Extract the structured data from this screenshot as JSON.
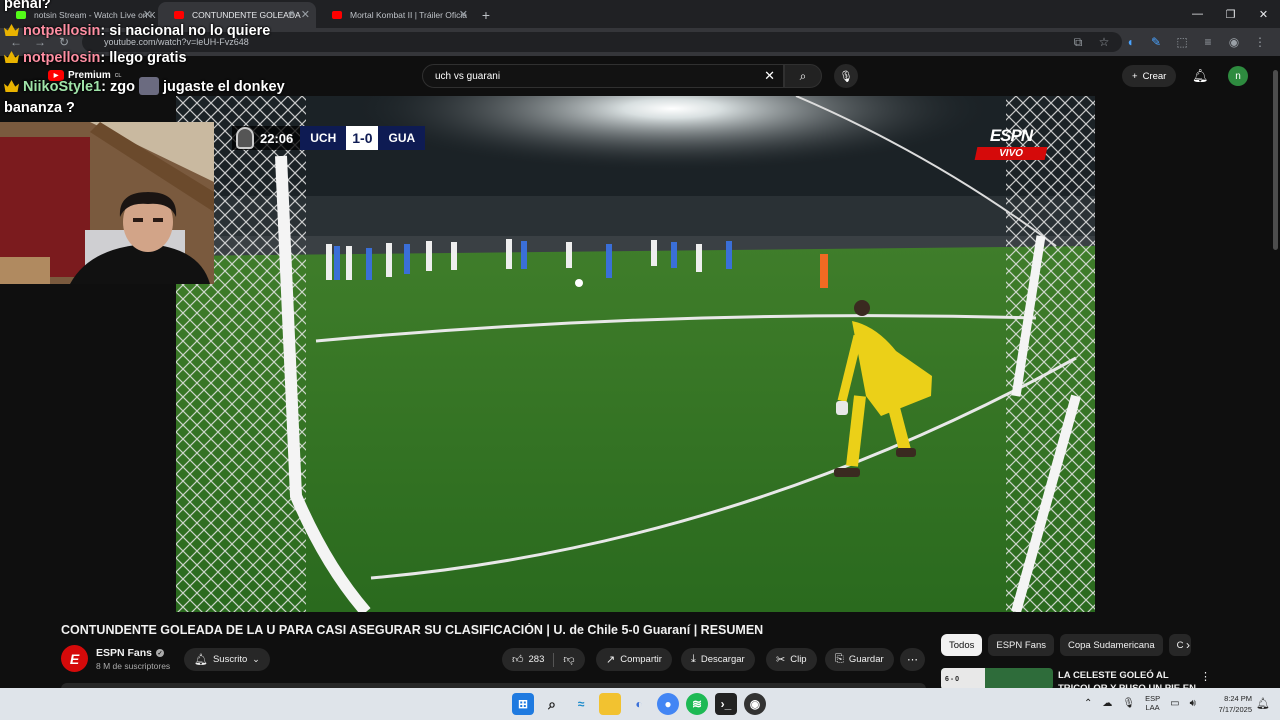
{
  "browser": {
    "tabs": [
      {
        "title": "notsin Stream - Watch Live on K",
        "favicon_color": "#53fc18",
        "active": false
      },
      {
        "title": "CONTUNDENTE GOLEADA",
        "favicon_color": "#ff0000",
        "active": true,
        "audio": true
      },
      {
        "title": "Mortal Kombat II | Tráiler Oficia",
        "favicon_color": "#ff0000",
        "active": false
      }
    ],
    "url": "youtube.com/watch?v=leUH-Fvz648"
  },
  "youtube": {
    "logo_text": "Premium",
    "logo_region": "CL",
    "search_query": "uch vs guarani",
    "create_label": "Crear",
    "user_initial": "n"
  },
  "scoreboard": {
    "time": "22:06",
    "home": "UCH",
    "score": "1-0",
    "away": "GUA"
  },
  "broadcaster": {
    "logo": "ESPN",
    "live_label": "VIVO"
  },
  "video": {
    "title": "CONTUNDENTE GOLEADA DE LA U PARA CASI ASEGURAR SU CLASIFICACIÓN | U. de Chile 5-0 Guaraní | RESUMEN",
    "channel": "ESPN Fans",
    "channel_initial": "E",
    "subscribers": "8 M de suscriptores",
    "subscribed_label": "Suscrito",
    "likes": "283",
    "share_label": "Compartir",
    "download_label": "Descargar",
    "clip_label": "Clip",
    "save_label": "Guardar"
  },
  "recommendations": {
    "chips": [
      "Todos",
      "ESPN Fans",
      "Copa Sudamericana",
      "C"
    ],
    "first_title": "LA CELESTE GOLEÓ AL TRICOLOR Y PUSO UN PIE EN",
    "first_thumb_text": "6 - 0"
  },
  "chat": {
    "lines": [
      {
        "user": "",
        "message": "penal?",
        "user_color": "#ffffff",
        "crown": false
      },
      {
        "user": "notpellosin",
        "message": ": si nacional no lo quiere",
        "user_color": "#ff8fa3",
        "crown": true
      },
      {
        "user": "notpellosin",
        "message": ": llego gratis",
        "user_color": "#ff8fa3",
        "crown": true
      },
      {
        "user": "NiikoStyle1",
        "message": ": zgo",
        "user_color": "#9fe3a8",
        "crown": true,
        "message_tail": "jugaste el donkey"
      },
      {
        "user": "",
        "message": "bananza ?",
        "user_color": "#ffffff",
        "crown": false
      }
    ]
  },
  "taskbar": {
    "lang_top": "ESP",
    "lang_bottom": "LAA",
    "time": "8:24 PM",
    "date": "7/17/2025"
  }
}
